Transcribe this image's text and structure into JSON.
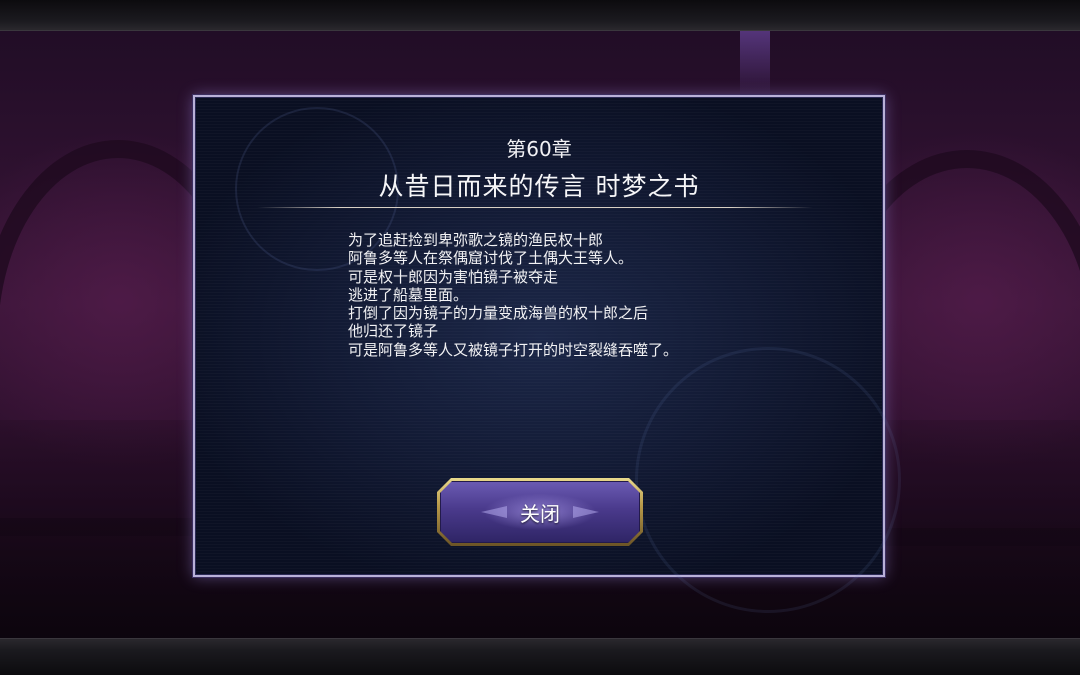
{
  "dialog": {
    "chapter_number": "第60章",
    "chapter_title": "从昔日而来的传言 时梦之书",
    "story_lines": [
      "为了追赶捡到卑弥歌之镜的渔民权十郎",
      "阿鲁多等人在祭偶窟讨伐了土偶大王等人。",
      "可是权十郎因为害怕镜子被夺走",
      "逃进了船墓里面。",
      "打倒了因为镜子的力量变成海兽的权十郎之后",
      "他归还了镜子",
      "可是阿鲁多等人又被镜子打开的时空裂缝吞噬了。"
    ],
    "close_label": "关闭"
  },
  "colors": {
    "panel_border": "#b9b1d8",
    "panel_bg": "#121a34",
    "button_frame": "#b99a4a",
    "button_fill": "#4a3a8c",
    "text": "#f2f2f4"
  }
}
